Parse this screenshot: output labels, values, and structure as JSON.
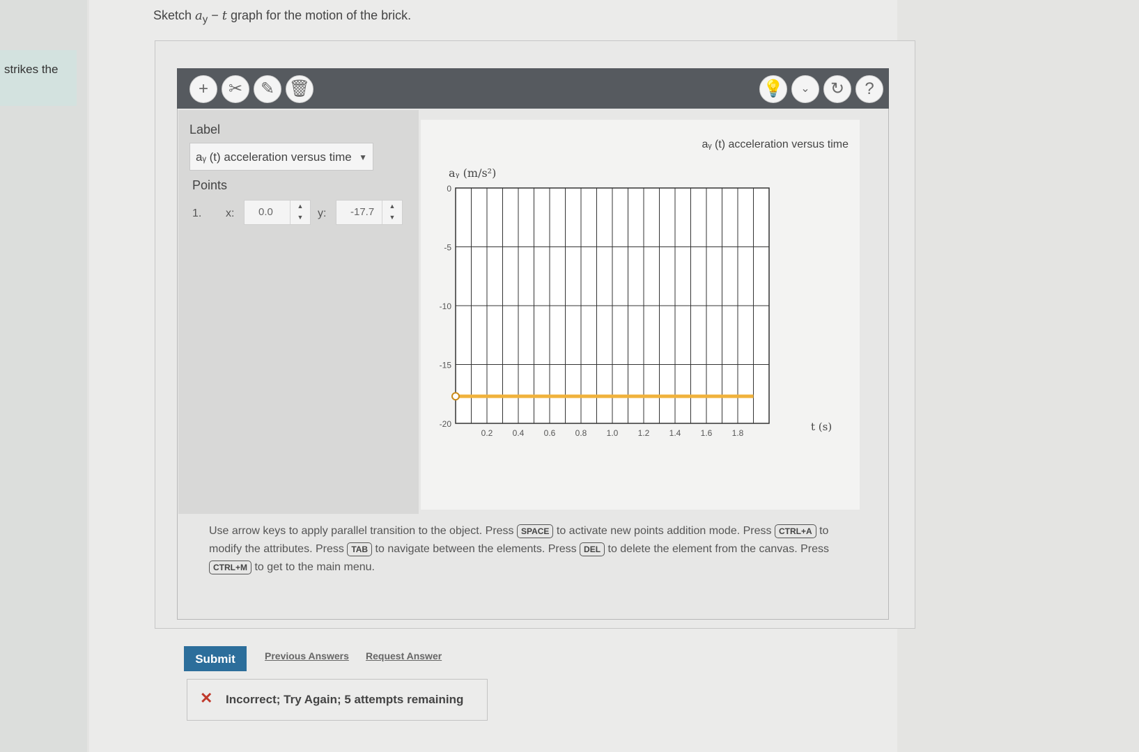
{
  "question": {
    "prefix": "Sketch ",
    "var_a": "a",
    "sub_y": "y",
    "dash": " − ",
    "var_t": "t",
    "suffix": " graph for the motion of the brick."
  },
  "left_snippet": "strikes the",
  "toolbar": {
    "add_icon": "plus-icon",
    "scissors_icon": "scissors-icon",
    "edit_icon": "edit-point-icon",
    "delete_icon": "trash-icon",
    "hint_icon": "lightbulb-icon",
    "dropdown_icon": "chevron-down-icon",
    "reset_icon": "reset-icon",
    "help_icon": "question-icon"
  },
  "side_panel": {
    "label_heading": "Label",
    "label_value": "aᵧ (t) acceleration versus time",
    "points_heading": "Points",
    "point_index": "1.",
    "x_label": "x:",
    "x_value": "0.0",
    "y_label": "y:",
    "y_value": "-17.7"
  },
  "chart_data": {
    "type": "line",
    "title": "aᵧ (t) acceleration versus time",
    "ylabel": "aᵧ (m/s²)",
    "xlabel": "t (s)",
    "xlim": [
      0,
      2.0
    ],
    "ylim": [
      -20,
      0
    ],
    "xticks": [
      0.2,
      0.4,
      0.6,
      0.8,
      1.0,
      1.2,
      1.4,
      1.6,
      1.8
    ],
    "xtick_labels": [
      "0.2",
      "0.4",
      "0.6",
      "0.8",
      "1.0",
      "1.2",
      "1.4",
      "1.6",
      "1.8"
    ],
    "yticks": [
      0,
      -5,
      -10,
      -15,
      -20
    ],
    "ytick_labels": [
      "0",
      "-5",
      "-10",
      "-15",
      "-20"
    ],
    "grid": true,
    "series": [
      {
        "x": [
          0.0,
          1.9
        ],
        "y": [
          -17.7,
          -17.7
        ],
        "color": "#f0b23c"
      }
    ]
  },
  "instructions": {
    "t1": "Use arrow keys to apply parallel transition to the object. Press ",
    "k1": "SPACE",
    "t2": " to activate new points addition mode. Press ",
    "k2": "CTRL+A",
    "t3": " to modify the attributes. Press ",
    "k3": "TAB",
    "t4": " to navigate between the elements. Press ",
    "k4": "DEL",
    "t5": " to delete the element from the canvas. Press ",
    "k5": "CTRL+M",
    "t6": " to get to the main menu."
  },
  "actions": {
    "submit": "Submit",
    "previous_answers": "Previous Answers",
    "request_answer": "Request Answer"
  },
  "feedback": {
    "text": "Incorrect; Try Again; 5 attempts remaining"
  }
}
